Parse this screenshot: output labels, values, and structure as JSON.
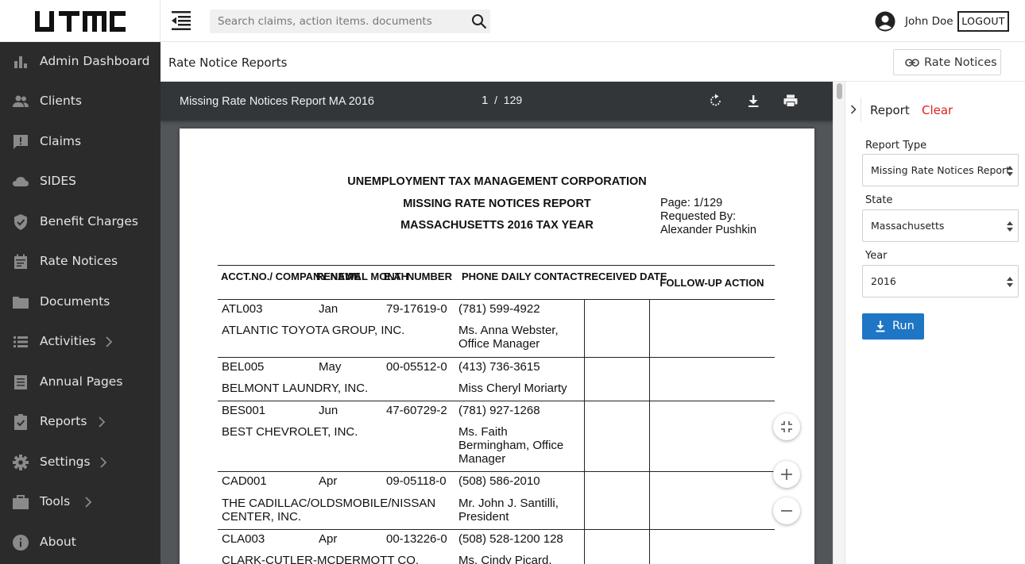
{
  "header": {
    "logo_text": "UTMC",
    "search_placeholder": "Search claims, action items. documents",
    "user_name": "John Doe",
    "logout_label": "LOGOUT"
  },
  "sidebar": {
    "items": [
      {
        "label": "Admin Dashboard",
        "icon": "bar-chart-icon",
        "has_submenu": false
      },
      {
        "label": "Clients",
        "icon": "people-icon",
        "has_submenu": false
      },
      {
        "label": "Claims",
        "icon": "comment-alert-icon",
        "has_submenu": false
      },
      {
        "label": "SIDES",
        "icon": "cloud-icon",
        "has_submenu": false
      },
      {
        "label": "Benefit Charges",
        "icon": "shield-check-icon",
        "has_submenu": false
      },
      {
        "label": "Rate Notices",
        "icon": "calendar-icon",
        "has_submenu": false
      },
      {
        "label": "Documents",
        "icon": "folder-icon",
        "has_submenu": false
      },
      {
        "label": "Activities",
        "icon": "list-icon",
        "has_submenu": true
      },
      {
        "label": "Annual Pages",
        "icon": "document-icon",
        "has_submenu": false
      },
      {
        "label": "Reports",
        "icon": "clipboard-check-icon",
        "has_submenu": true
      },
      {
        "label": "Settings",
        "icon": "gear-icon",
        "has_submenu": true
      },
      {
        "label": "Tools",
        "icon": "briefcase-icon",
        "has_submenu": true
      },
      {
        "label": "About",
        "icon": "info-icon",
        "has_submenu": false
      }
    ]
  },
  "content": {
    "page_title": "Rate Notice Reports",
    "rate_notices_button": "Rate Notices"
  },
  "viewer": {
    "doc_title": "Missing Rate Notices Report MA 2016",
    "current_page": "1",
    "page_separator": "/",
    "total_pages": "129"
  },
  "report": {
    "line1": "UNEMPLOYMENT TAX MANAGEMENT CORPORATION",
    "line2": "MISSING RATE NOTICES REPORT",
    "line3": "MASSACHUSETTS 2016 TAX YEAR",
    "page_info": "Page: 1/129",
    "requested_by_label": "Requested By:",
    "requested_by_name": "Alexander Pushkin",
    "columns": [
      "ACCT.NO./\nCOMPANY NAME",
      "RENEWAL\nMONTH",
      "E.A.\nNUMBER",
      "PHONE\nDAILY CONTACT",
      "RECEIVED\nDATE",
      "FOLLOW-UP ACTION"
    ],
    "rows": [
      {
        "acct": "ATL003",
        "month": "Jan",
        "ea": "79-17619-0",
        "phone": "(781) 599-4922",
        "company": "ATLANTIC TOYOTA GROUP, INC.",
        "contact": "Ms. Anna Webster,\nOffice Manager"
      },
      {
        "acct": "BEL005",
        "month": "May",
        "ea": "00-05512-0",
        "phone": "(413) 736-3615",
        "company": "BELMONT LAUNDRY, INC.",
        "contact": "Miss Cheryl Moriarty"
      },
      {
        "acct": "BES001",
        "month": "Jun",
        "ea": "47-60729-2",
        "phone": "(781) 927-1268",
        "company": "BEST CHEVROLET, INC.",
        "contact": "Ms. Faith\nBermingham, Office\nManager"
      },
      {
        "acct": "CAD001",
        "month": "Apr",
        "ea": "09-05118-0",
        "phone": "(508) 586-2010",
        "company": "THE CADILLAC/OLDSMOBILE/NISSAN\nCENTER, INC.",
        "contact": "Mr. John J. Santilli,\nPresident"
      },
      {
        "acct": "CLA003",
        "month": "Apr",
        "ea": "00-13226-0",
        "phone": "(508) 528-1200 128",
        "company": "CLARK-CUTLER-MCDERMOTT CO.",
        "contact": "Ms. Cindy Picard,"
      }
    ]
  },
  "panel": {
    "tab_label": "Report",
    "clear_label": "Clear",
    "report_type_label": "Report Type",
    "report_type_value": "Missing Rate Notices Report",
    "state_label": "State",
    "state_value": "Massachusetts",
    "year_label": "Year",
    "year_value": "2016",
    "run_label": "Run"
  },
  "colors": {
    "sidebar_bg": "#2b2b2b",
    "viewer_bg": "#525659",
    "viewer_toolbar": "#323639",
    "accent_blue": "#1e76c4",
    "clear_red": "#e02020"
  }
}
